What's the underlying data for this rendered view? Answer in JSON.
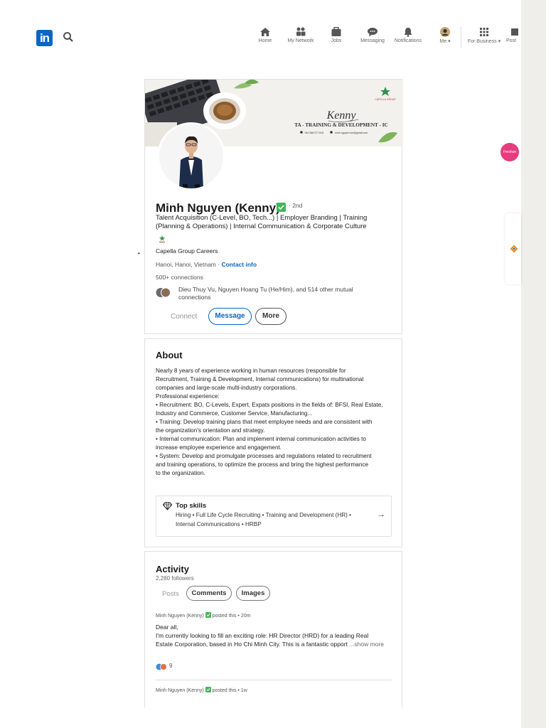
{
  "nav": {
    "logo": "in",
    "items": [
      "Home",
      "My Network",
      "Jobs",
      "Messaging",
      "Notifications",
      "Me",
      "For Business",
      "Post"
    ],
    "floating_badge": "Freshon"
  },
  "profile": {
    "banner": {
      "company": "CAPELLA GROUP",
      "signature": "Kenny",
      "title": "TA - TRAINING & DEVELOPMENT - IC",
      "phone": "+84 388 977 815",
      "email": "minh.nguyen.ivn@gmail.com"
    },
    "name": "Minh Nguyen (Kenny)",
    "degree": "· 2nd",
    "headline_1": "Talent Acquisition (C-Level, BO, Tech...) | Employer Branding | Training",
    "headline_2": "(Planning & Operations) | Internal Communication & Corporate Culture",
    "company": "Capella Group Careers",
    "location": "Hanoi, Hanoi, Vietnam ·",
    "contact_link": "Contact info",
    "connections": "500+ connections",
    "mutual_1": "Dieu Thuy Vu, Nguyen Hoang Tu (He/Him), and 514 other mutual",
    "mutual_2": "connections",
    "actions": {
      "connect": "Connect",
      "message": "Message",
      "more": "More"
    }
  },
  "about": {
    "title": "About",
    "lines": [
      "Nearly 8 years of experience working in human resources (responsible for",
      "Recruitment, Training & Development, Internal communications) for multinational",
      "companies and large-scale multi-industry corporations.",
      "Professional experience:",
      "• Recruitment: BO, C-Levels, Expert, Expats positions in the fields of: BFSI, Real Estate,",
      "Industry and Commerce, Customer Service, Manufacturing...",
      "• Training: Develop training plans that meet employee needs and are consistent with",
      "the organization's orientation and strategy.",
      "• Internal communication: Plan and implement internal communication activities to",
      "increase employee experience and engagement.",
      "• System: Develop and promulgate processes and regulations related to recruitment",
      "and training operations, to optimize the process and bring the highest performance",
      "to the organization."
    ],
    "top_skills_title": "Top skills",
    "top_skills_1": "Hiring • Full Life Cycle Recruiting • Training and Development (HR) •",
    "top_skills_2": "Internal Communications • HRBP"
  },
  "activity": {
    "title": "Activity",
    "followers": "2,280 followers",
    "tabs": [
      "Posts",
      "Comments",
      "Images"
    ],
    "post1": {
      "author": "Minh Nguyen (Kenny)",
      "meta": "posted this • 20m",
      "line1": "Dear all,",
      "line2": "I'm currently looking to fill an exciting role: HR Director (HRD) for a leading Real",
      "line3": "Estate Corporation, based in Ho Chi Minh City. This is a fantastic opport",
      "show_more": "...show more",
      "reactions": "9"
    },
    "post2": {
      "author": "Minh Nguyen (Kenny)",
      "meta": "posted this • 1w"
    }
  },
  "colors": {
    "brand": "#0a66c2",
    "verified": "#44b65a",
    "text": "#222222",
    "muted": "#666666"
  }
}
